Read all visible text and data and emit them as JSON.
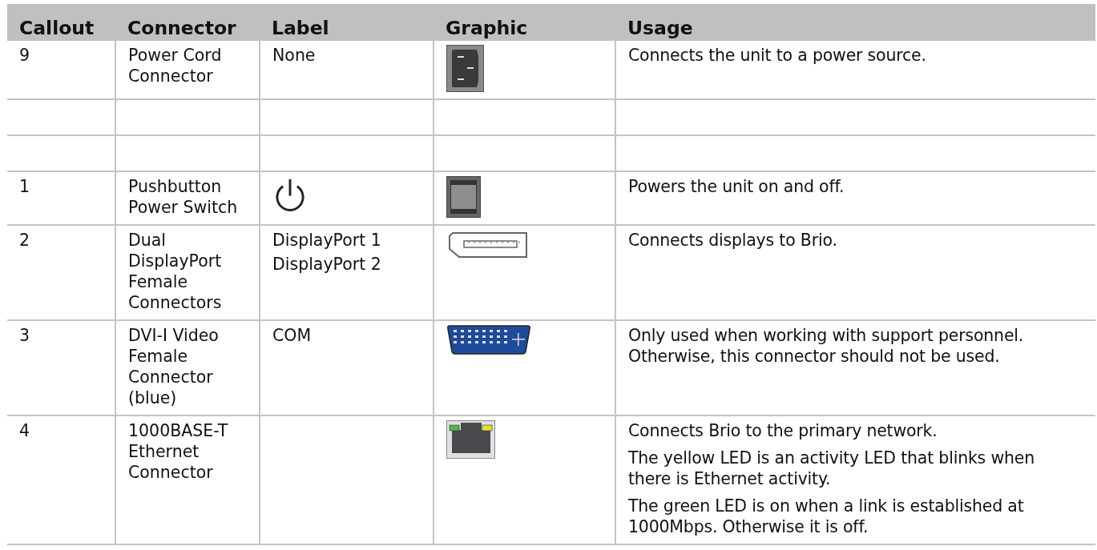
{
  "table": {
    "columns": [
      "Callout",
      "Connector",
      "Label",
      "Graphic",
      "Usage"
    ],
    "rows": [
      {
        "kind": "connector",
        "callout": "9",
        "connector": "Power Cord Connector",
        "label": {
          "kind": "text",
          "lines": [
            "None"
          ]
        },
        "graphic": {
          "kind": "power-inlet"
        },
        "usage": [
          "Connects the unit to a power source."
        ]
      },
      {
        "kind": "empty",
        "label": {
          "kind": "text"
        },
        "graphic": {
          "kind": "none"
        }
      },
      {
        "kind": "empty",
        "label": {
          "kind": "text"
        },
        "graphic": {
          "kind": "none"
        }
      },
      {
        "kind": "connector",
        "callout": "1",
        "connector": "Pushbutton Power Switch",
        "label": {
          "kind": "power-symbol"
        },
        "graphic": {
          "kind": "switch"
        },
        "usage": [
          "Powers the unit on and off."
        ]
      },
      {
        "kind": "connector",
        "callout": "2",
        "connector": "Dual DisplayPort Female Connectors",
        "label": {
          "kind": "text",
          "lines": [
            "DisplayPort 1",
            "DisplayPort 2"
          ]
        },
        "graphic": {
          "kind": "displayport"
        },
        "usage": [
          "Connects displays to Brio."
        ]
      },
      {
        "kind": "connector",
        "callout": "3",
        "connector": "DVI-I Video Female Connector (blue)",
        "label": {
          "kind": "text",
          "lines": [
            "COM"
          ]
        },
        "graphic": {
          "kind": "dvi"
        },
        "usage": [
          "Only used when working with support personnel. Otherwise, this connector should not be used."
        ]
      },
      {
        "kind": "connector",
        "callout": "4",
        "connector": "1000BASE-T Ethernet Connector",
        "label": {
          "kind": "text"
        },
        "graphic": {
          "kind": "ethernet"
        },
        "usage": [
          "Connects Brio to the primary network.",
          "The yellow LED is an activity LED that blinks when there is Ethernet activity.",
          "The green LED is on when a link is established at 1000Mbps. Otherwise it is off."
        ]
      }
    ]
  }
}
